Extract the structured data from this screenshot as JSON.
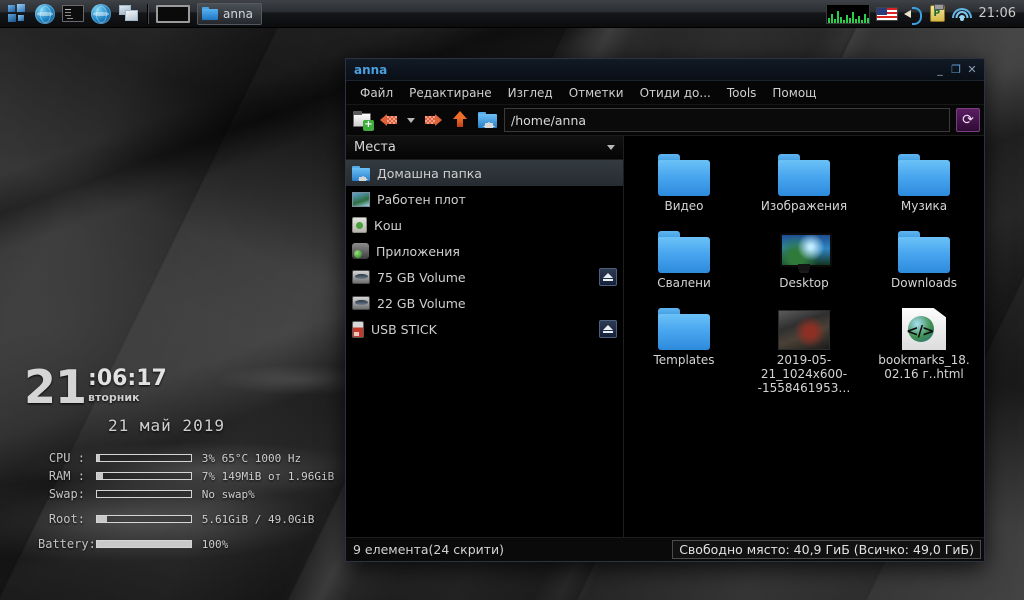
{
  "panel": {
    "launchers": [
      {
        "name": "applications-menu",
        "icon": "apps-grid-icon"
      },
      {
        "name": "web-browser",
        "icon": "globe-icon"
      },
      {
        "name": "terminal",
        "icon": "terminal-icon"
      },
      {
        "name": "browser2",
        "icon": "globe-icon"
      },
      {
        "name": "window-list",
        "icon": "windows-icon"
      }
    ],
    "show_desktop": "show-desktop-icon",
    "task": {
      "label": "anna",
      "icon": "folder-icon"
    },
    "tray": {
      "graph": "cpu-graph-icon",
      "keyboard_layout": "us-flag-icon",
      "volume": "speaker-icon",
      "clipboard": "clipboard-icon",
      "network": "wifi-icon",
      "clock": "21:06"
    }
  },
  "conky": {
    "hour": "21",
    "minsec": ":06:17",
    "weekday": "вторник",
    "date": "21 май 2019",
    "rows": [
      {
        "label": "CPU :",
        "value": "3%  65°C 1000 Hz",
        "pct": 3
      },
      {
        "label": "RAM :",
        "value": "7% 149MiB от 1.96GiB",
        "pct": 7
      },
      {
        "label": "Swap:",
        "value": "No swap%",
        "pct": 0
      },
      {
        "label": "Root:",
        "value": "5.61GiB / 49.0GiB",
        "pct": 11
      },
      {
        "label": "Battery:",
        "value": "100%",
        "pct": 100
      }
    ]
  },
  "filemanager": {
    "title": "anna",
    "window_buttons": {
      "minimize": "_",
      "maximize": "❐",
      "close": "✕"
    },
    "menu": [
      "Файл",
      "Редактиране",
      "Изглед",
      "Отметки",
      "Отиди до...",
      "Tools",
      "Помощ"
    ],
    "toolbar": {
      "new_window": "new-window-icon",
      "back": "back-arrow-icon",
      "history_dropdown": "chevron-down-icon",
      "forward": "forward-arrow-icon",
      "up": "up-arrow-icon",
      "home": "home-folder-icon",
      "reload": "reload-icon"
    },
    "path": {
      "value": "/home/anna",
      "placeholder": "/home/anna"
    },
    "sidebar": {
      "header": "Места",
      "items": [
        {
          "label": "Домашна папка",
          "icon": "home-folder-icon",
          "selected": true,
          "eject": false
        },
        {
          "label": "Работен плот",
          "icon": "desktop-icon",
          "selected": false,
          "eject": false
        },
        {
          "label": "Кош",
          "icon": "trash-icon",
          "selected": false,
          "eject": false
        },
        {
          "label": "Приложения",
          "icon": "applications-icon",
          "selected": false,
          "eject": false
        },
        {
          "label": "75 GB Volume",
          "icon": "drive-icon",
          "selected": false,
          "eject": true
        },
        {
          "label": "22 GB Volume",
          "icon": "drive-icon",
          "selected": false,
          "eject": false
        },
        {
          "label": "USB STICK",
          "icon": "usb-icon",
          "selected": false,
          "eject": true
        }
      ]
    },
    "files": [
      {
        "label": "Видео",
        "icon": "folder-icon"
      },
      {
        "label": "Изображения",
        "icon": "folder-icon"
      },
      {
        "label": "Музика",
        "icon": "folder-icon"
      },
      {
        "label": "Свалени",
        "icon": "folder-icon"
      },
      {
        "label": "Desktop",
        "icon": "monitor-thumbnail"
      },
      {
        "label": "Downloads",
        "icon": "folder-icon"
      },
      {
        "label": "Templates",
        "icon": "folder-icon"
      },
      {
        "label": "2019-05-21_1024x600--1558461953…",
        "icon": "image-thumbnail"
      },
      {
        "label": "bookmarks_18.02.16 г..html",
        "icon": "html-file-icon"
      }
    ],
    "status": {
      "items": "9 елемента(24 скрити)",
      "space": "Свободно място: 40,9 ГиБ (Всичко: 49,0 ГиБ)"
    }
  },
  "colors": {
    "accent_blue": "#4a9fe0",
    "folder_blue": "#49a6ef",
    "panel_dark": "#0b0c0e",
    "window_bg": "#0a0a0a"
  }
}
